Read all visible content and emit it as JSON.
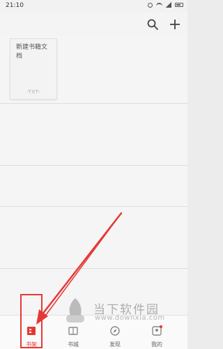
{
  "status_bar": {
    "time": "21:10"
  },
  "book": {
    "title": "新建书籍文档",
    "format": "-TXT-"
  },
  "tabs": [
    {
      "label": "书架",
      "active": true
    },
    {
      "label": "书城",
      "active": false
    },
    {
      "label": "发现",
      "active": false
    },
    {
      "label": "我的",
      "active": false
    }
  ],
  "watermark": {
    "brand_cn": "当下软件园",
    "brand_url": "www.downxia.com"
  },
  "colors": {
    "accent": "#e53935",
    "background": "#ececec"
  }
}
